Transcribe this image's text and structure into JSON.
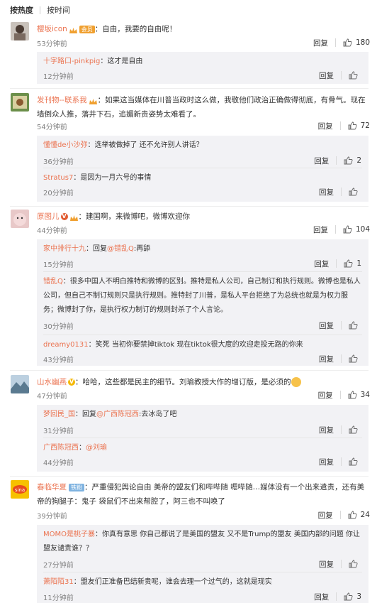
{
  "sort_tabs": {
    "hot": "按热度",
    "time": "按时间"
  },
  "reply_label": "回复",
  "comments": [
    {
      "user": "樱坂icon",
      "badge": "会员",
      "text": "：自由，我要的自由呢！",
      "time": "53分钟前",
      "likes": "180"
    },
    {
      "user": "发刊物--联系我",
      "text": "：如果这当媒体在川普当政时这么做，我敬他们政治正确做得彻底，有骨气。现在墙倒众人推，落井下石，追媚新贵姿势太难看了。",
      "time": "54分钟前",
      "likes": "72"
    },
    {
      "user": "原图儿",
      "text": "：建国啊，来微博吧，微博欢迎你",
      "time": "44分钟前",
      "likes": "104"
    },
    {
      "user": "山水幽燕",
      "text": "：哈哈，这些都是民主的细节。刘瑜教授大作的增订版，是必须的",
      "time": "47分钟前",
      "likes": "34"
    },
    {
      "user": "春临华夏",
      "badge": "铁粉",
      "text": "：严重侵犯舆论自由 美帝的盟友们和哔哔随 嗯哔随…媒体没有一个出来遣责，还有美帝的狗腿子：鬼子 袋鼠们不出来帮腔了，阿三也不叫唤了",
      "time": "39分钟前",
      "likes": "24"
    }
  ],
  "replies_1": [
    {
      "user": "十字路口-pinkpig",
      "text": "：这才是自由",
      "time": "12分钟前",
      "likes": ""
    }
  ],
  "replies_2": [
    {
      "user": "懂懂de小沙弥",
      "text": "：选举被做掉了  还不允许别人讲话？",
      "time": "36分钟前",
      "likes": "2"
    },
    {
      "user": "Stratus7",
      "text": "：是因为一月六号的事情",
      "time": "20分钟前",
      "likes": ""
    }
  ],
  "replies_3": [
    {
      "user": "家中排行十九",
      "text": "：回复",
      "mention": "@错乱Q",
      "text2": ":再舔",
      "time": "15分钟前",
      "likes": "1"
    },
    {
      "user": "错乱Q",
      "text": "：很多中国人不明白推特和微博的区别。推特是私人公司，自己制订和执行规则。微博也是私人公司，但自己不制订规则只是执行规则。推特封了川普，是私人平台拒绝了为总统也就是为权力服务；微博封了你，是执行权力制订的规则封杀了个人言论。",
      "time": "30分钟前",
      "likes": ""
    },
    {
      "user": "dreamy0131",
      "text": "：笑死 当初你要禁掉tiktok 现在tiktok很大度的欢迎走投无路的你来",
      "time": "43分钟前",
      "likes": ""
    }
  ],
  "replies_4": [
    {
      "user": "梦回民_国",
      "text": "：回复",
      "mention": "@广西陈冠西",
      "text2": ":去冰岛了吧",
      "time": "31分钟前",
      "likes": ""
    },
    {
      "user": "广西陈冠西",
      "text": "：",
      "mention": "@刘瑜",
      "text2": "",
      "time": "44分钟前",
      "likes": ""
    }
  ],
  "replies_5": [
    {
      "user": "MOMO是桃子暴",
      "text": "：你真有意思 你自己都说了是美国的盟友 又不是Trump的盟友 美国内部的问题 你让盟友谴责谁？？",
      "time": "27分钟前",
      "likes": ""
    },
    {
      "user": "萧陌陌31",
      "text": "：盟友们正准备巴结新贵呢，谁会去理一个过气的，这就是现实",
      "time": "11分钟前",
      "likes": "3"
    }
  ],
  "colors": {
    "username": "#eb7350",
    "reply_bg": "#f2f2f5",
    "meta": "#808080"
  }
}
